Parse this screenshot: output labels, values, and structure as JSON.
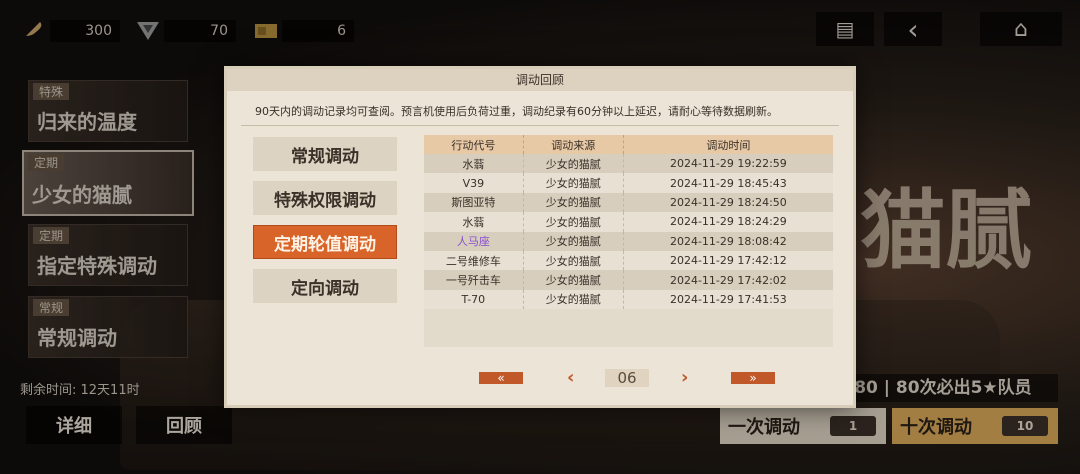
{
  "top": {
    "resources": [
      {
        "icon": "feather-icon",
        "value": "300"
      },
      {
        "icon": "triangle-emblem-icon",
        "value": "70"
      },
      {
        "icon": "ticket-icon",
        "value": "6"
      }
    ],
    "buttons": [
      {
        "name": "notebook-button",
        "icon": "notebook-icon",
        "glyph": "▤"
      },
      {
        "name": "back-button",
        "icon": "back-arrow-icon",
        "glyph": "‹"
      },
      {
        "name": "home-button",
        "icon": "home-icon",
        "glyph": "⌂"
      }
    ]
  },
  "pools": [
    {
      "tag": "特殊",
      "title": "归来的温度"
    },
    {
      "tag": "定期",
      "title": "少女的猫腻"
    },
    {
      "tag": "定期",
      "title": "指定特殊调动"
    },
    {
      "tag": "常规",
      "title": "常规调动"
    }
  ],
  "background_title": "猫腻",
  "remaining_time": "剩余时间: 12天11时",
  "bottom_buttons": {
    "detail": "详细",
    "review": "回顾"
  },
  "guarantee": "/80 | 80次必出5★队员",
  "draw": {
    "single": {
      "label": "一次调动",
      "count": "1"
    },
    "ten": {
      "label": "十次调动",
      "count": "10"
    }
  },
  "modal": {
    "title": "调动回顾",
    "note": "90天内的调动记录均可查阅。预言机使用后负荷过重，调动纪录有60分钟以上延迟，请耐心等待数据刷新。",
    "tabs": [
      "常规调动",
      "特殊权限调动",
      "定期轮值调动",
      "定向调动"
    ],
    "active_tab": 2,
    "table": {
      "headers": [
        "行动代号",
        "调动来源",
        "调动时间"
      ],
      "rows": [
        {
          "name": "水蓊",
          "source": "少女的猫腻",
          "time": "2024-11-29 19:22:59",
          "rarity_color": "#3a3028"
        },
        {
          "name": "V39",
          "source": "少女的猫腻",
          "time": "2024-11-29 18:45:43",
          "rarity_color": "#3a3028"
        },
        {
          "name": "斯图亚特",
          "source": "少女的猫腻",
          "time": "2024-11-29 18:24:50",
          "rarity_color": "#3a3028"
        },
        {
          "name": "水蓊",
          "source": "少女的猫腻",
          "time": "2024-11-29 18:24:29",
          "rarity_color": "#3a3028"
        },
        {
          "name": "人马座",
          "source": "少女的猫腻",
          "time": "2024-11-29 18:08:42",
          "rarity_color": "#8a4fd0"
        },
        {
          "name": "二号维修车",
          "source": "少女的猫腻",
          "time": "2024-11-29 17:42:12",
          "rarity_color": "#3a3028"
        },
        {
          "name": "一号歼击车",
          "source": "少女的猫腻",
          "time": "2024-11-29 17:42:02",
          "rarity_color": "#3a3028"
        },
        {
          "name": "T-70",
          "source": "少女的猫腻",
          "time": "2024-11-29 17:41:53",
          "rarity_color": "#3a3028"
        }
      ]
    },
    "pager": {
      "first": "«",
      "prev": "‹",
      "page": "06",
      "next": "›",
      "last": "»"
    }
  },
  "colors": {
    "accent": "#d8642a",
    "panel": "#ece4d6",
    "header": "#e8c9a6"
  }
}
